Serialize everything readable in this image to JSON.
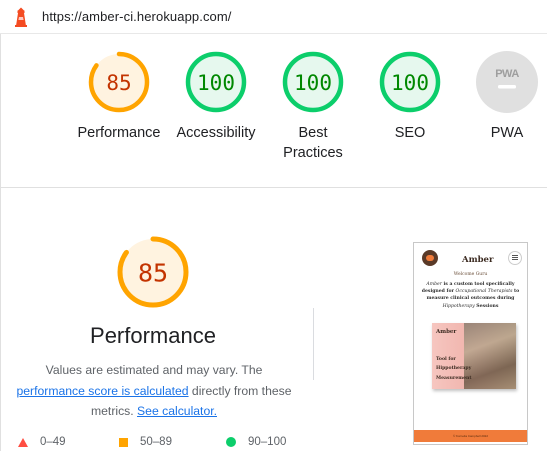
{
  "address_bar": {
    "url": "https://amber-ci.herokuapp.com/",
    "icon": "lighthouse-icon"
  },
  "categories": [
    {
      "id": "performance",
      "score": "85",
      "label": "Performance",
      "status": "average"
    },
    {
      "id": "accessibility",
      "score": "100",
      "label": "Accessibility",
      "status": "pass"
    },
    {
      "id": "best-practices",
      "score": "100",
      "label": "Best Practices",
      "status": "pass"
    },
    {
      "id": "seo",
      "score": "100",
      "label": "SEO",
      "status": "pass"
    },
    {
      "id": "pwa",
      "score": "PWA",
      "label": "PWA",
      "status": "na"
    }
  ],
  "performance": {
    "score": "85",
    "title": "Performance",
    "desc_before": "Values are estimated and may vary. The ",
    "desc_link1": "performance score is calculated",
    "desc_middle": " directly from these metrics. ",
    "desc_link2": "See calculator."
  },
  "legend": [
    {
      "range": "0–49",
      "shape": "triangle",
      "color": "#ff4e42"
    },
    {
      "range": "50–89",
      "shape": "square",
      "color": "#ffa400"
    },
    {
      "range": "90–100",
      "shape": "circle",
      "color": "#0cce6b"
    }
  ],
  "preview": {
    "brand": "Amber",
    "welcome": "Welcome Guru",
    "intro_1": "Amber",
    "intro_2": " is a custom tool specifically designed for ",
    "intro_3": "Occupational Therapists",
    "intro_4": " to measure clinical outcomes during ",
    "intro_5": "Hippotherapy",
    "intro_6": " Sessions",
    "card_title": "Amber",
    "card_line1": "Tool for",
    "card_line2": "Hippotherapy",
    "card_line3": "Measurement",
    "footer": "© Kornelia Campbell 2022"
  },
  "colors": {
    "average": "#ffa400",
    "average_text": "#c33300",
    "average_bg": "#fff3e0",
    "pass": "#0cce6b",
    "pass_text": "#008800",
    "pass_bg": "#e6f8ee",
    "na": "#e0e0e0",
    "link": "#1a73e8"
  }
}
